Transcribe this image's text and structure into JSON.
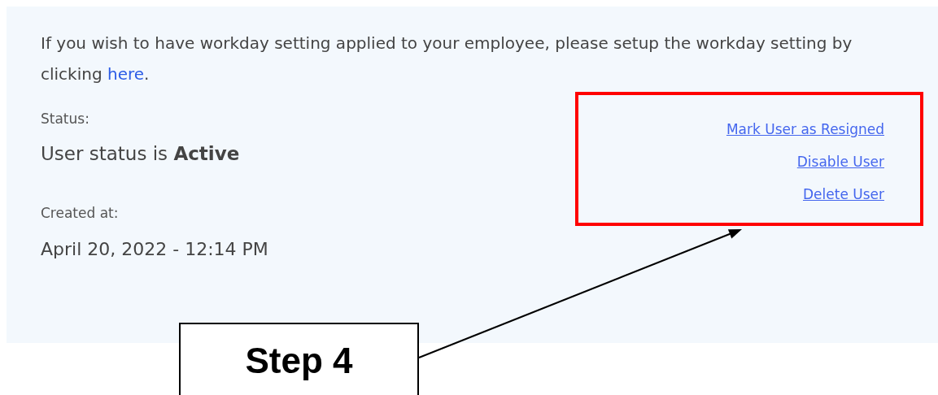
{
  "intro": {
    "text": "If you wish to have workday setting applied to your employee, please setup the workday setting by clicking ",
    "link": "here",
    "end": "."
  },
  "status": {
    "label": "Status:",
    "value": "User status is **Active**"
  },
  "created": {
    "label": "Created at:",
    "value": "April 20, 2022 - 12:14 PM"
  },
  "actions": [
    {
      "label": "Mark User as Resigned"
    },
    {
      "label": "Disable User"
    },
    {
      "label": "Delete User"
    }
  ],
  "annotation": {
    "label": "Step 4"
  }
}
